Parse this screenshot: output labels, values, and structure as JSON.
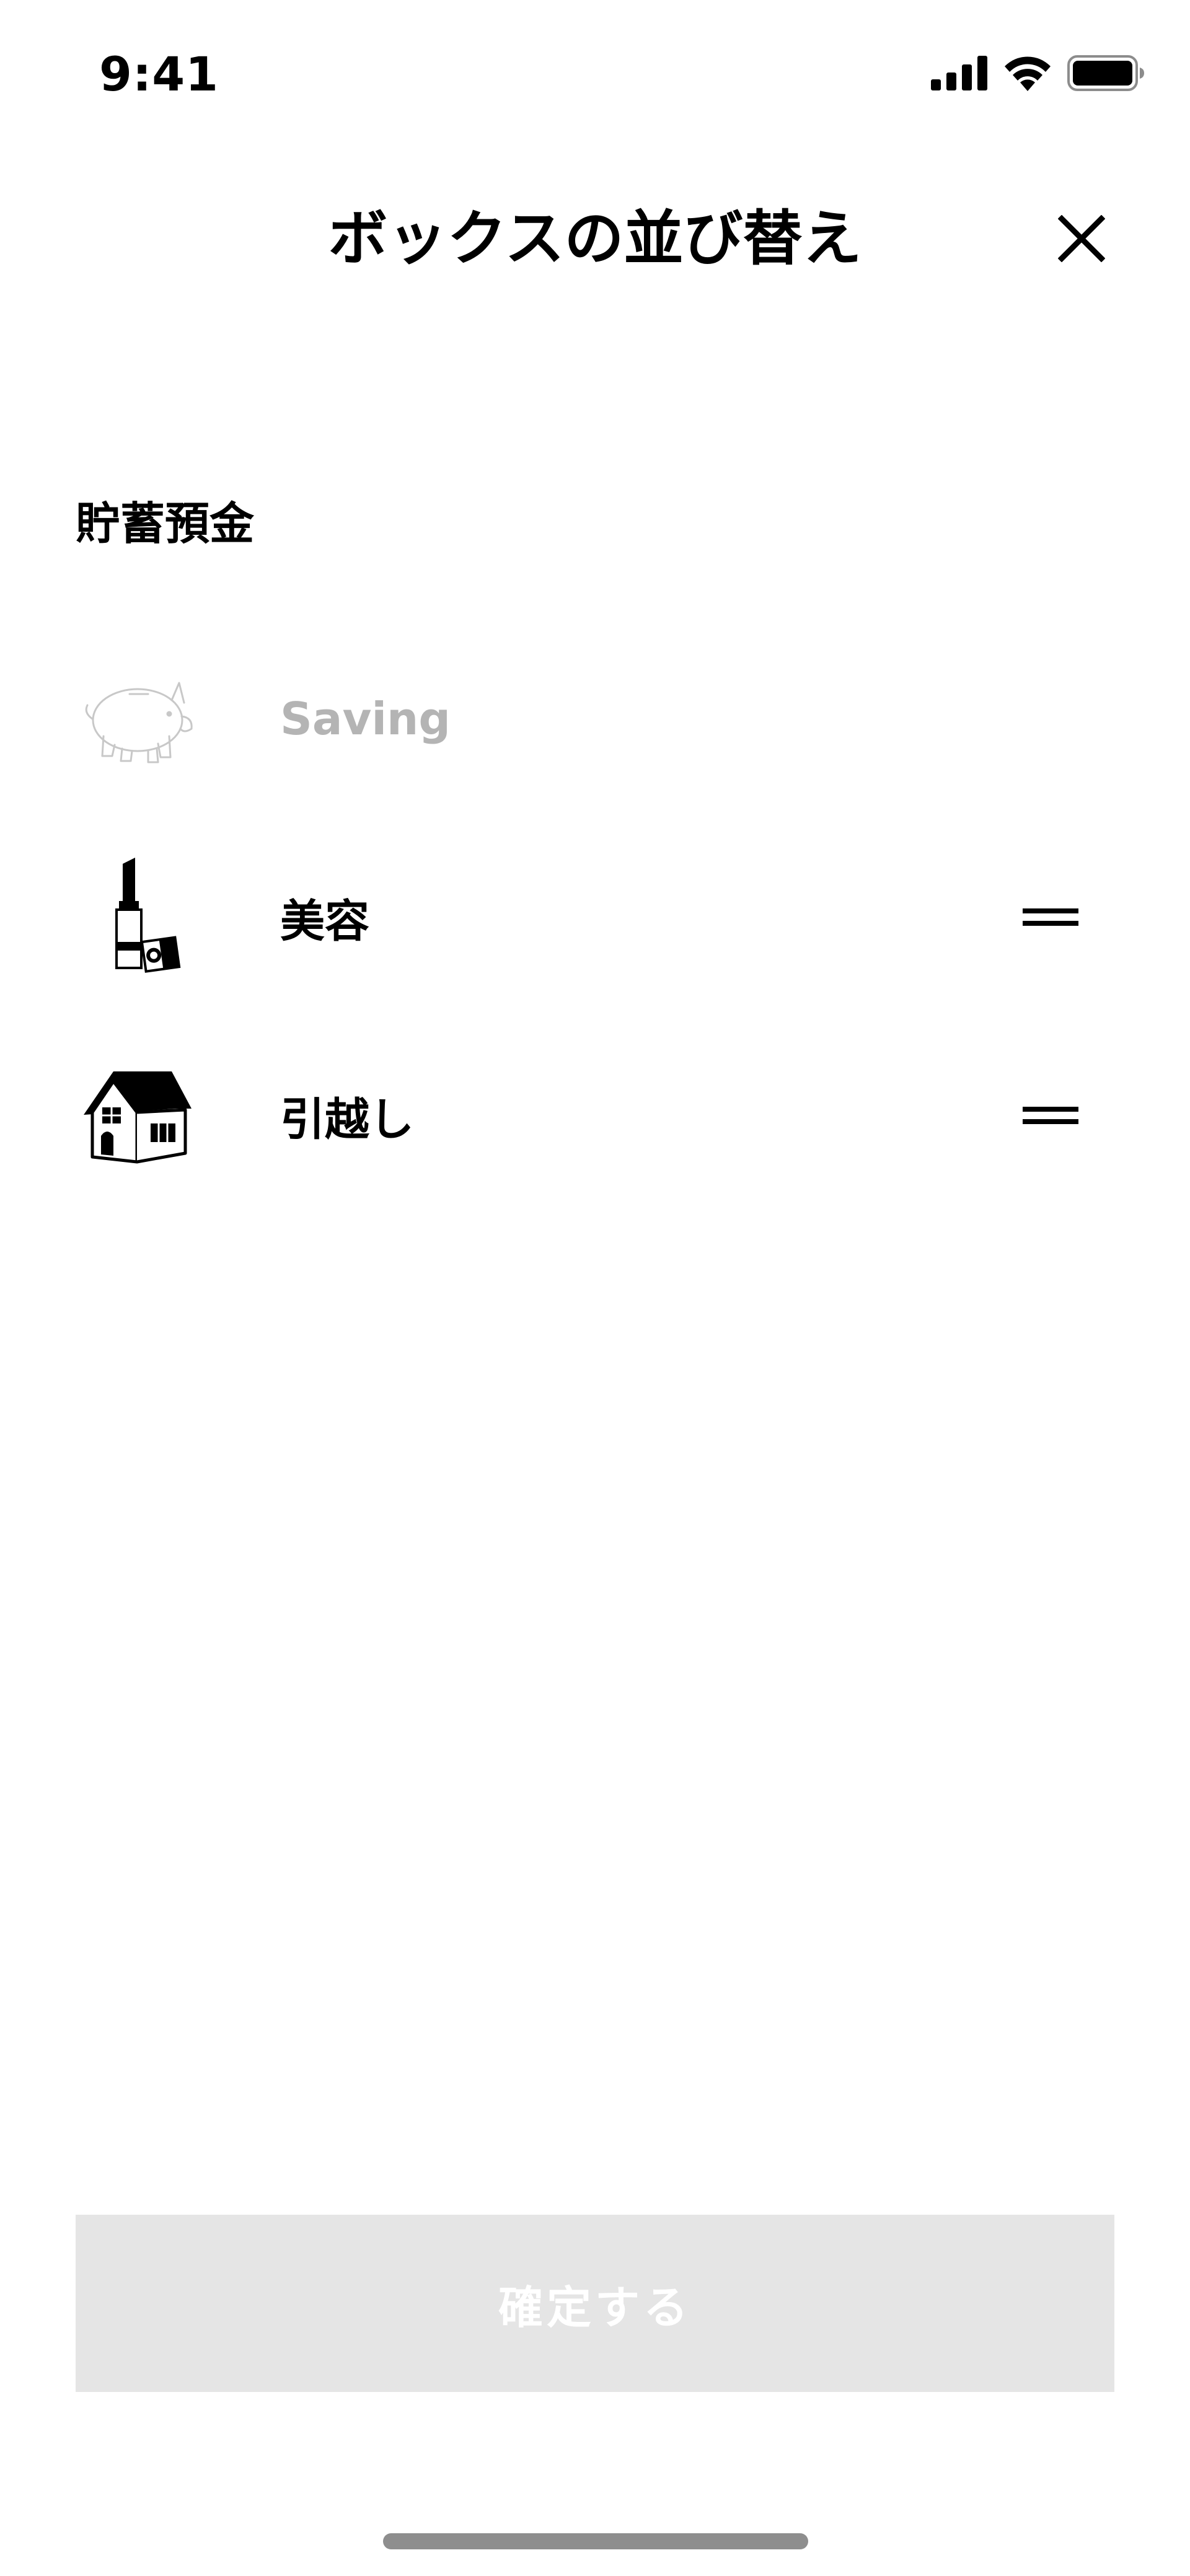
{
  "status_bar": {
    "time": "9:41",
    "icons": [
      "cellular-signal-icon",
      "wifi-icon",
      "battery-icon"
    ]
  },
  "header": {
    "title": "ボックスの並び替え",
    "close_icon": "close-icon"
  },
  "section": {
    "title": "貯蓄預金",
    "items": [
      {
        "label": "Saving",
        "icon": "piggy-bank-icon",
        "reorderable": false
      },
      {
        "label": "美容",
        "icon": "lipstick-icon",
        "reorderable": true
      },
      {
        "label": "引越し",
        "icon": "house-icon",
        "reorderable": true
      }
    ]
  },
  "confirm_button": {
    "label": "確定する",
    "enabled": false
  },
  "colors": {
    "text": "#000000",
    "disabled_text": "#b4b4b4",
    "button_disabled_bg": "#e5e5e5",
    "button_text": "#ffffff",
    "home_indicator": "#8e8e8e"
  }
}
